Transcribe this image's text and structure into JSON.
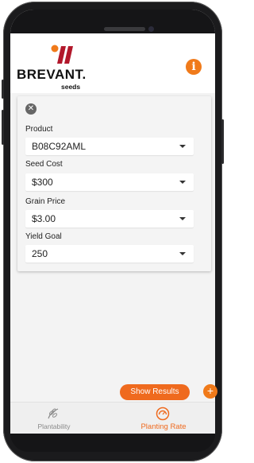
{
  "app": {
    "logo_text": "BREVANT.",
    "logo_sub": "seeds",
    "info_icon": "info-icon"
  },
  "form": {
    "close_icon": "close-icon",
    "fields": [
      {
        "label": "Product",
        "value": "B08C92AML"
      },
      {
        "label": "Seed Cost",
        "value": "$300"
      },
      {
        "label": "Grain Price",
        "value": "$3.00"
      },
      {
        "label": "Yield Goal",
        "value": "250"
      }
    ]
  },
  "actions": {
    "show_results": "Show Results",
    "add": "+"
  },
  "tabs": [
    {
      "label": "Plantability",
      "icon": "plant-seed-icon",
      "active": false
    },
    {
      "label": "Planting Rate",
      "icon": "gauge-icon",
      "active": true
    }
  ],
  "colors": {
    "accent": "#ef6a1e",
    "logo_red": "#b2182b",
    "tab_inactive": "#8a8a8a"
  }
}
